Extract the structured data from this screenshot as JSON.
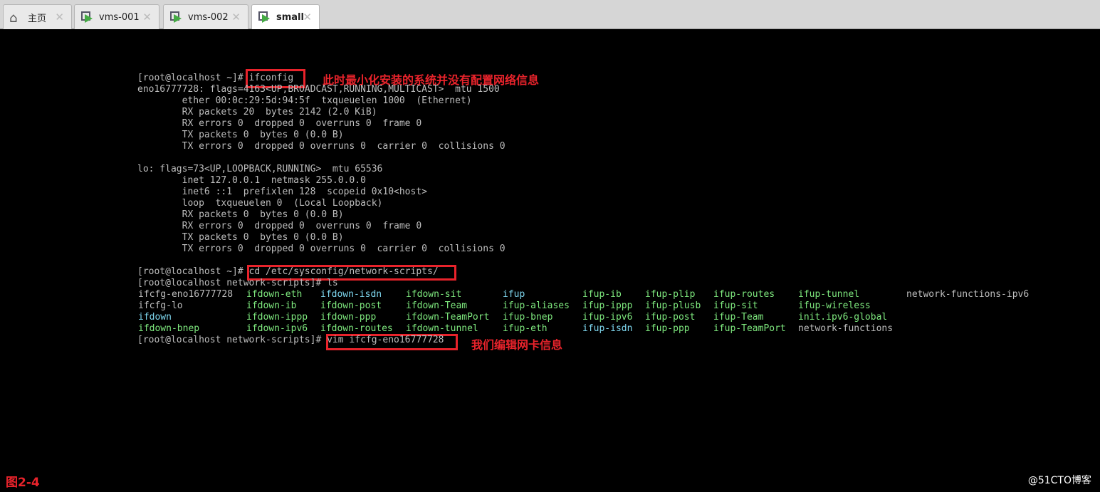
{
  "tabs": [
    {
      "label": "主页",
      "icon": "home-icon",
      "active": false
    },
    {
      "label": "vms-001",
      "icon": "vm-icon",
      "active": false
    },
    {
      "label": "vms-002",
      "icon": "vm-icon",
      "active": false
    },
    {
      "label": "small",
      "icon": "vm-icon",
      "active": true
    }
  ],
  "close_glyph": "✕",
  "colors": {
    "text": "#bdbdbd",
    "green": "#7ee87e",
    "cyan": "#7fd8f0",
    "annotation": "#e8232b"
  },
  "terminal_lines": [
    "[root@localhost ~]# ifconfig",
    "eno16777728: flags=4163<UP,BROADCAST,RUNNING,MULTICAST>  mtu 1500",
    "        ether 00:0c:29:5d:94:5f  txqueuelen 1000  (Ethernet)",
    "        RX packets 20  bytes 2142 (2.0 KiB)",
    "        RX errors 0  dropped 0  overruns 0  frame 0",
    "        TX packets 0  bytes 0 (0.0 B)",
    "        TX errors 0  dropped 0 overruns 0  carrier 0  collisions 0",
    "",
    "lo: flags=73<UP,LOOPBACK,RUNNING>  mtu 65536",
    "        inet 127.0.0.1  netmask 255.0.0.0",
    "        inet6 ::1  prefixlen 128  scopeid 0x10<host>",
    "        loop  txqueuelen 0  (Local Loopback)",
    "        RX packets 0  bytes 0 (0.0 B)",
    "        RX errors 0  dropped 0  overruns 0  frame 0",
    "        TX packets 0  bytes 0 (0.0 B)",
    "        TX errors 0  dropped 0 overruns 0  carrier 0  collisions 0",
    "",
    "[root@localhost ~]# cd /etc/sysconfig/network-scripts/",
    "[root@localhost network-scripts]# ls"
  ],
  "ls_rows": [
    [
      [
        "ifcfg-eno16777728",
        "w"
      ],
      [
        "ifdown-eth",
        "g"
      ],
      [
        "ifdown-isdn",
        "c"
      ],
      [
        "ifdown-sit",
        "g"
      ],
      [
        "ifup",
        "c"
      ],
      [
        "ifup-ib",
        "g"
      ],
      [
        "ifup-plip",
        "g"
      ],
      [
        "ifup-routes",
        "g"
      ],
      [
        "ifup-tunnel",
        "g"
      ],
      [
        "network-functions-ipv6",
        "w"
      ]
    ],
    [
      [
        "ifcfg-lo",
        "w"
      ],
      [
        "ifdown-ib",
        "g"
      ],
      [
        "ifdown-post",
        "g"
      ],
      [
        "ifdown-Team",
        "g"
      ],
      [
        "ifup-aliases",
        "g"
      ],
      [
        "ifup-ippp",
        "g"
      ],
      [
        "ifup-plusb",
        "g"
      ],
      [
        "ifup-sit",
        "g"
      ],
      [
        "ifup-wireless",
        "g"
      ]
    ],
    [
      [
        "ifdown",
        "c"
      ],
      [
        "ifdown-ippp",
        "g"
      ],
      [
        "ifdown-ppp",
        "g"
      ],
      [
        "ifdown-TeamPort",
        "g"
      ],
      [
        "ifup-bnep",
        "g"
      ],
      [
        "ifup-ipv6",
        "g"
      ],
      [
        "ifup-post",
        "g"
      ],
      [
        "ifup-Team",
        "g"
      ],
      [
        "init.ipv6-global",
        "g"
      ]
    ],
    [
      [
        "ifdown-bnep",
        "g"
      ],
      [
        "ifdown-ipv6",
        "g"
      ],
      [
        "ifdown-routes",
        "g"
      ],
      [
        "ifdown-tunnel",
        "g"
      ],
      [
        "ifup-eth",
        "g"
      ],
      [
        "ifup-isdn",
        "c"
      ],
      [
        "ifup-ppp",
        "g"
      ],
      [
        "ifup-TeamPort",
        "g"
      ],
      [
        "network-functions",
        "w"
      ]
    ]
  ],
  "last_line": "[root@localhost network-scripts]# vim ifcfg-eno16777728",
  "annotations": {
    "ifconfig": "此时最小化安装的系统并没有配置网络信息",
    "vim": "我们编辑网卡信息"
  },
  "figure_label": "图2-4",
  "watermark": "@51CTO博客"
}
